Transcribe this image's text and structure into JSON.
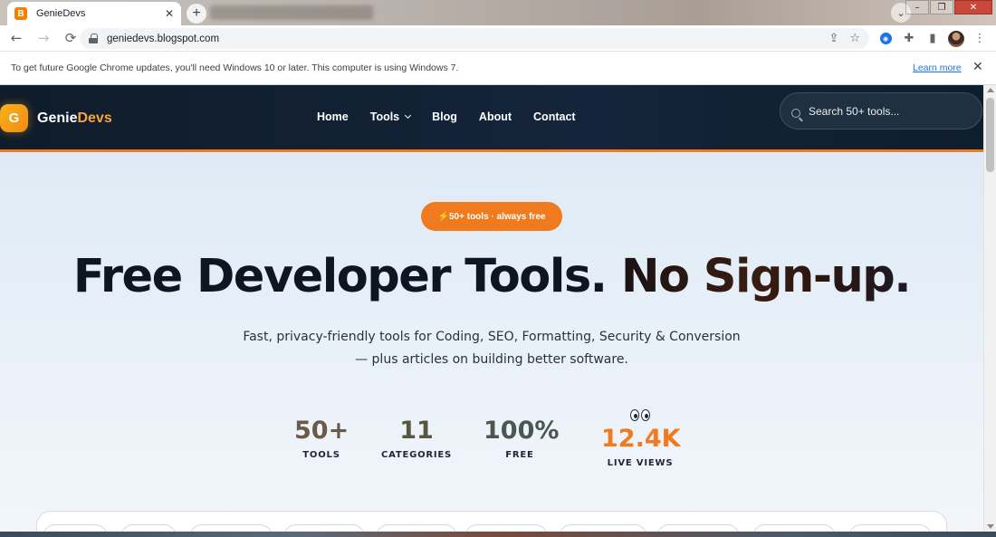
{
  "browser": {
    "tab_title": "GenieDevs",
    "tab_favicon_letter": "B",
    "tab_close": "✕",
    "new_tab": "+",
    "url": "geniedevs.blogspot.com",
    "back": "←",
    "forward": "→",
    "reload": "⟳"
  },
  "infobar": {
    "message": "To get future Google Chrome updates, you'll need Windows 10 or later. This computer is using Windows 7.",
    "link": "Learn more",
    "close": "✕"
  },
  "site": {
    "logo_letter": "G",
    "logo_name_part1": "Genie",
    "logo_name_part2": "Devs",
    "nav": {
      "home": "Home",
      "tools": "Tools",
      "blog": "Blog",
      "about": "About",
      "contact": "Contact"
    },
    "search_placeholder": "Search 50+ tools..."
  },
  "hero": {
    "badge": "⚡50+ tools · always free",
    "title_part1": "Free Developer Tools.",
    "title_part2": "No Sign-up.",
    "subtitle_line1": "Fast, privacy-friendly tools for Coding, SEO, Formatting, Security & Conversion",
    "subtitle_line2": "— plus articles on building better software."
  },
  "stats": [
    {
      "value": "50+",
      "label": "TOOLS"
    },
    {
      "value": "11",
      "label": "CATEGORIES"
    },
    {
      "value": "100%",
      "label": "FREE"
    },
    {
      "value": "12.4K",
      "label": "LIVE VIEWS"
    }
  ],
  "colors": {
    "accent_orange": "#f07a1e",
    "header_bg": "#0f1c2a",
    "hero_bg": "#dbe8f5"
  }
}
